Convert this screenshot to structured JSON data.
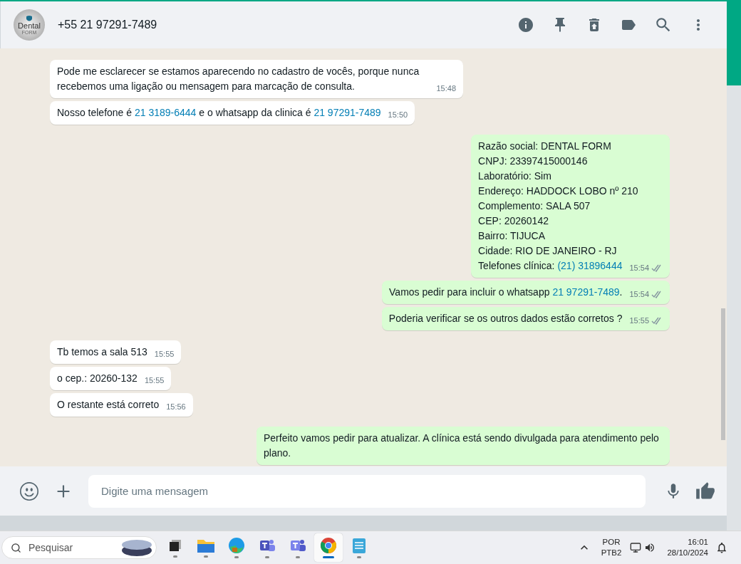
{
  "header": {
    "avatar_text": "Dental",
    "avatar_subtext": "FORM",
    "title": "+55 21 97291-7489"
  },
  "messages": [
    {
      "kind": "in",
      "time": "15:48",
      "lines": [
        [
          {
            "text": "Pode me esclarecer se estamos aparecendo no cadastro de vocês, porque nunca recebemos uma ligação ou mensagem para marcação de consulta."
          }
        ]
      ]
    },
    {
      "kind": "in",
      "time": "15:50",
      "lines": [
        [
          {
            "text": "Nosso telefone é "
          },
          {
            "text": "21 3189-6444",
            "link": true
          },
          {
            "text": " e o whatsapp da clinica é "
          },
          {
            "text": "21 97291-7489",
            "link": true
          }
        ]
      ]
    },
    {
      "kind": "out",
      "time": "15:54",
      "read": false,
      "lines": [
        [
          {
            "text": "Razão social: DENTAL FORM"
          }
        ],
        [
          {
            "text": "CNPJ: 23397415000146"
          }
        ],
        [
          {
            "text": "Laboratório: Sim"
          }
        ],
        [
          {
            "text": "Endereço: HADDOCK LOBO nº 210"
          }
        ],
        [
          {
            "text": "Complemento: SALA 507"
          }
        ],
        [
          {
            "text": "CEP: 20260142"
          }
        ],
        [
          {
            "text": "Bairro: TIJUCA"
          }
        ],
        [
          {
            "text": "Cidade: RIO DE JANEIRO - RJ"
          }
        ],
        [
          {
            "text": "Telefones clínica: "
          },
          {
            "text": "(21) 31896444",
            "link": true
          }
        ]
      ]
    },
    {
      "kind": "out",
      "time": "15:54",
      "read": false,
      "lines": [
        [
          {
            "text": "Vamos pedir para incluir o whatsapp  "
          },
          {
            "text": "21 97291-7489",
            "link": true
          },
          {
            "text": "."
          }
        ]
      ]
    },
    {
      "kind": "out",
      "time": "15:55",
      "read": false,
      "lines": [
        [
          {
            "text": "Poderia verificar se os outros dados estão corretos ?"
          }
        ]
      ]
    },
    {
      "kind": "in",
      "time": "15:55",
      "lines": [
        [
          {
            "text": "Tb temos a sala 513"
          }
        ]
      ]
    },
    {
      "kind": "in",
      "time": "15:55",
      "lines": [
        [
          {
            "text": "o cep.: 20260-132"
          }
        ]
      ]
    },
    {
      "kind": "in",
      "time": "15:56",
      "lines": [
        [
          {
            "text": "O restante está correto"
          }
        ]
      ]
    },
    {
      "kind": "out",
      "lines": [
        [
          {
            "text": "Perfeito vamos pedir para atualizar. A clínica está sendo divulgada para atendimento pelo plano."
          }
        ]
      ]
    }
  ],
  "composer": {
    "placeholder": "Digite uma mensagem"
  },
  "taskbar": {
    "search_placeholder": "Pesquisar",
    "apps": [
      {
        "kind": "taskview",
        "selected": false
      },
      {
        "kind": "folder",
        "selected": false
      },
      {
        "kind": "edge",
        "selected": false
      },
      {
        "kind": "teams",
        "selected": false
      },
      {
        "kind": "teams2",
        "selected": false
      },
      {
        "kind": "chrome",
        "selected": true
      },
      {
        "kind": "notepad",
        "selected": false
      }
    ],
    "language": "POR",
    "layout": "PTB2",
    "time": "16:01",
    "date": "28/10/2024"
  }
}
